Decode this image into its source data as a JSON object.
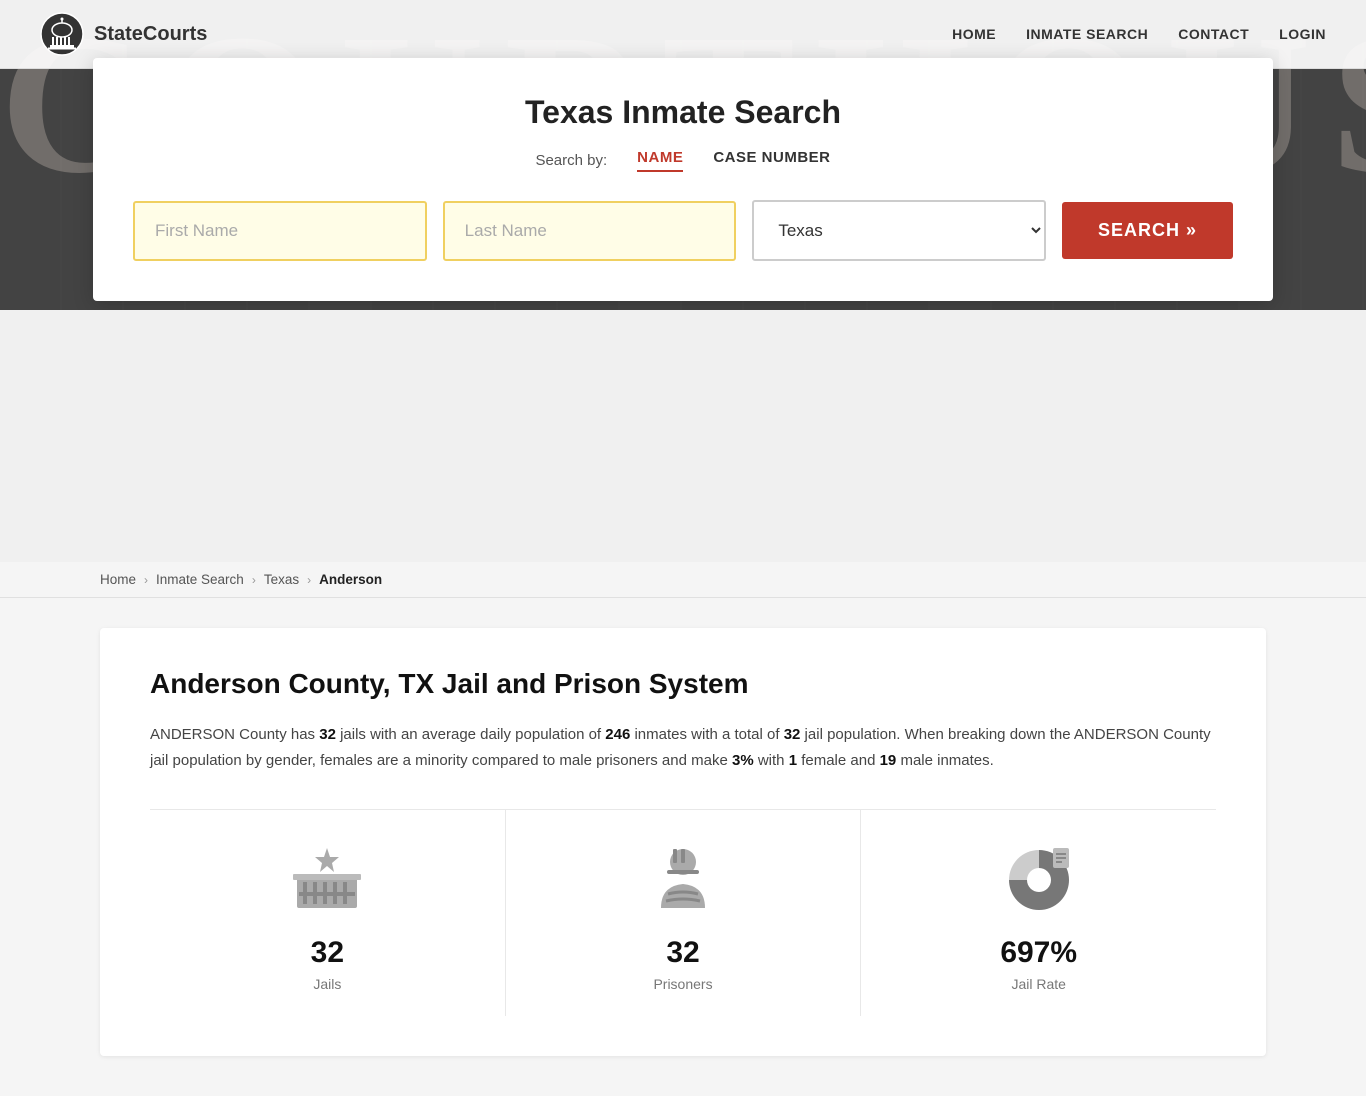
{
  "site": {
    "name": "StateCourts",
    "title": "Texas Inmate Search"
  },
  "nav": {
    "links": [
      "HOME",
      "INMATE SEARCH",
      "CONTACT",
      "LOGIN"
    ]
  },
  "header_bg_text": "COURTHOUSE",
  "search": {
    "title": "Texas Inmate Search",
    "search_by_label": "Search by:",
    "tabs": [
      {
        "label": "NAME",
        "active": true
      },
      {
        "label": "CASE NUMBER",
        "active": false
      }
    ],
    "first_name_placeholder": "First Name",
    "last_name_placeholder": "Last Name",
    "state_value": "Texas",
    "search_button_label": "SEARCH »"
  },
  "breadcrumb": {
    "items": [
      "Home",
      "Inmate Search",
      "Texas",
      "Anderson"
    ]
  },
  "county": {
    "title": "Anderson County, TX Jail and Prison System",
    "description_parts": {
      "intro": "ANDERSON County has ",
      "jails_count": "32",
      "mid1": " jails with an average daily population of ",
      "avg_pop": "246",
      "mid2": " inmates with a total of ",
      "total_pop": "32",
      "mid3": " jail population. When breaking down the ANDERSON County jail population by gender, females are a minority compared to male prisoners and make ",
      "female_pct": "3%",
      "mid4": " with ",
      "female_count": "1",
      "mid5": " female and ",
      "male_count": "19",
      "end": " male inmates."
    },
    "stats": [
      {
        "value": "32",
        "label": "Jails",
        "icon_type": "jail"
      },
      {
        "value": "32",
        "label": "Prisoners",
        "icon_type": "prisoner"
      },
      {
        "value": "697%",
        "label": "Jail Rate",
        "icon_type": "pie"
      }
    ]
  },
  "colors": {
    "red": "#c0392b",
    "yellow_border": "#f0d060",
    "yellow_bg": "#fffde7"
  }
}
